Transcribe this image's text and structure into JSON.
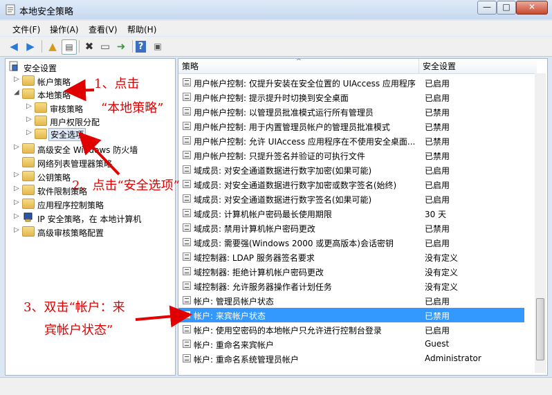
{
  "window": {
    "title": "本地安全策略",
    "minimize": "—",
    "maximize": "□",
    "close": "✕"
  },
  "menu": [
    "文件(F)",
    "操作(A)",
    "查看(V)",
    "帮助(H)"
  ],
  "toolbar_icons": [
    "back-arrow-icon",
    "forward-arrow-icon",
    "up-folder-icon",
    "show-tree-icon",
    "delete-icon",
    "properties-icon",
    "export-icon",
    "help-icon",
    "console-icon"
  ],
  "tree": {
    "root": "安全设置",
    "items": [
      {
        "label": "帐户策略",
        "expanded": false
      },
      {
        "label": "本地策略",
        "expanded": true
      },
      {
        "label": "审核策略"
      },
      {
        "label": "用户权限分配"
      },
      {
        "label": "安全选项",
        "selected": true
      },
      {
        "label": "高级安全 Windows 防火墙"
      },
      {
        "label": "网络列表管理器策略"
      },
      {
        "label": "公钥策略"
      },
      {
        "label": "软件限制策略"
      },
      {
        "label": "应用程序控制策略"
      },
      {
        "label": "IP 安全策略，在 本地计算机"
      },
      {
        "label": "高级审核策略配置"
      }
    ]
  },
  "table": {
    "col_policy": "策略",
    "col_setting": "安全设置",
    "rows": [
      {
        "policy": "用户帐户控制: 仅提升安装在安全位置的 UIAccess 应用程序",
        "setting": "已启用"
      },
      {
        "policy": "用户帐户控制: 提示提升时切换到安全桌面",
        "setting": "已启用"
      },
      {
        "policy": "用户帐户控制: 以管理员批准模式运行所有管理员",
        "setting": "已禁用"
      },
      {
        "policy": "用户帐户控制: 用于内置管理员帐户的管理员批准模式",
        "setting": "已禁用"
      },
      {
        "policy": "用户帐户控制: 允许 UIAccess 应用程序在不使用安全桌面...",
        "setting": "已禁用"
      },
      {
        "policy": "用户帐户控制: 只提升签名并验证的可执行文件",
        "setting": "已禁用"
      },
      {
        "policy": "域成员: 对安全通道数据进行数字加密(如果可能)",
        "setting": "已启用"
      },
      {
        "policy": "域成员: 对安全通道数据进行数字加密或数字签名(始终)",
        "setting": "已启用"
      },
      {
        "policy": "域成员: 对安全通道数据进行数字签名(如果可能)",
        "setting": "已启用"
      },
      {
        "policy": "域成员: 计算机帐户密码最长使用期限",
        "setting": "30 天"
      },
      {
        "policy": "域成员: 禁用计算机帐户密码更改",
        "setting": "已禁用"
      },
      {
        "policy": "域成员: 需要强(Windows 2000 或更高版本)会话密钥",
        "setting": "已启用"
      },
      {
        "policy": "域控制器: LDAP 服务器签名要求",
        "setting": "没有定义"
      },
      {
        "policy": "域控制器: 拒绝计算机帐户密码更改",
        "setting": "没有定义"
      },
      {
        "policy": "域控制器: 允许服务器操作者计划任务",
        "setting": "没有定义"
      },
      {
        "policy": "帐户: 管理员帐户状态",
        "setting": "已启用"
      },
      {
        "policy": "帐户: 来宾帐户状态",
        "setting": "已禁用",
        "selected": true
      },
      {
        "policy": "帐户: 使用空密码的本地帐户只允许进行控制台登录",
        "setting": "已启用"
      },
      {
        "policy": "帐户: 重命名来宾帐户",
        "setting": "Guest"
      },
      {
        "policy": "帐户: 重命名系统管理员帐户",
        "setting": "Administrator"
      }
    ]
  },
  "annotations": {
    "step1_line1": "1、点击",
    "step1_line2": "“本地策略”",
    "step2": "2、点击“安全选项”",
    "step3_line1": "3、双击“帐户：来",
    "step3_line2": "宾帐户状态”"
  },
  "colors": {
    "selection": "#3399ff",
    "annotation": "#e10000"
  }
}
